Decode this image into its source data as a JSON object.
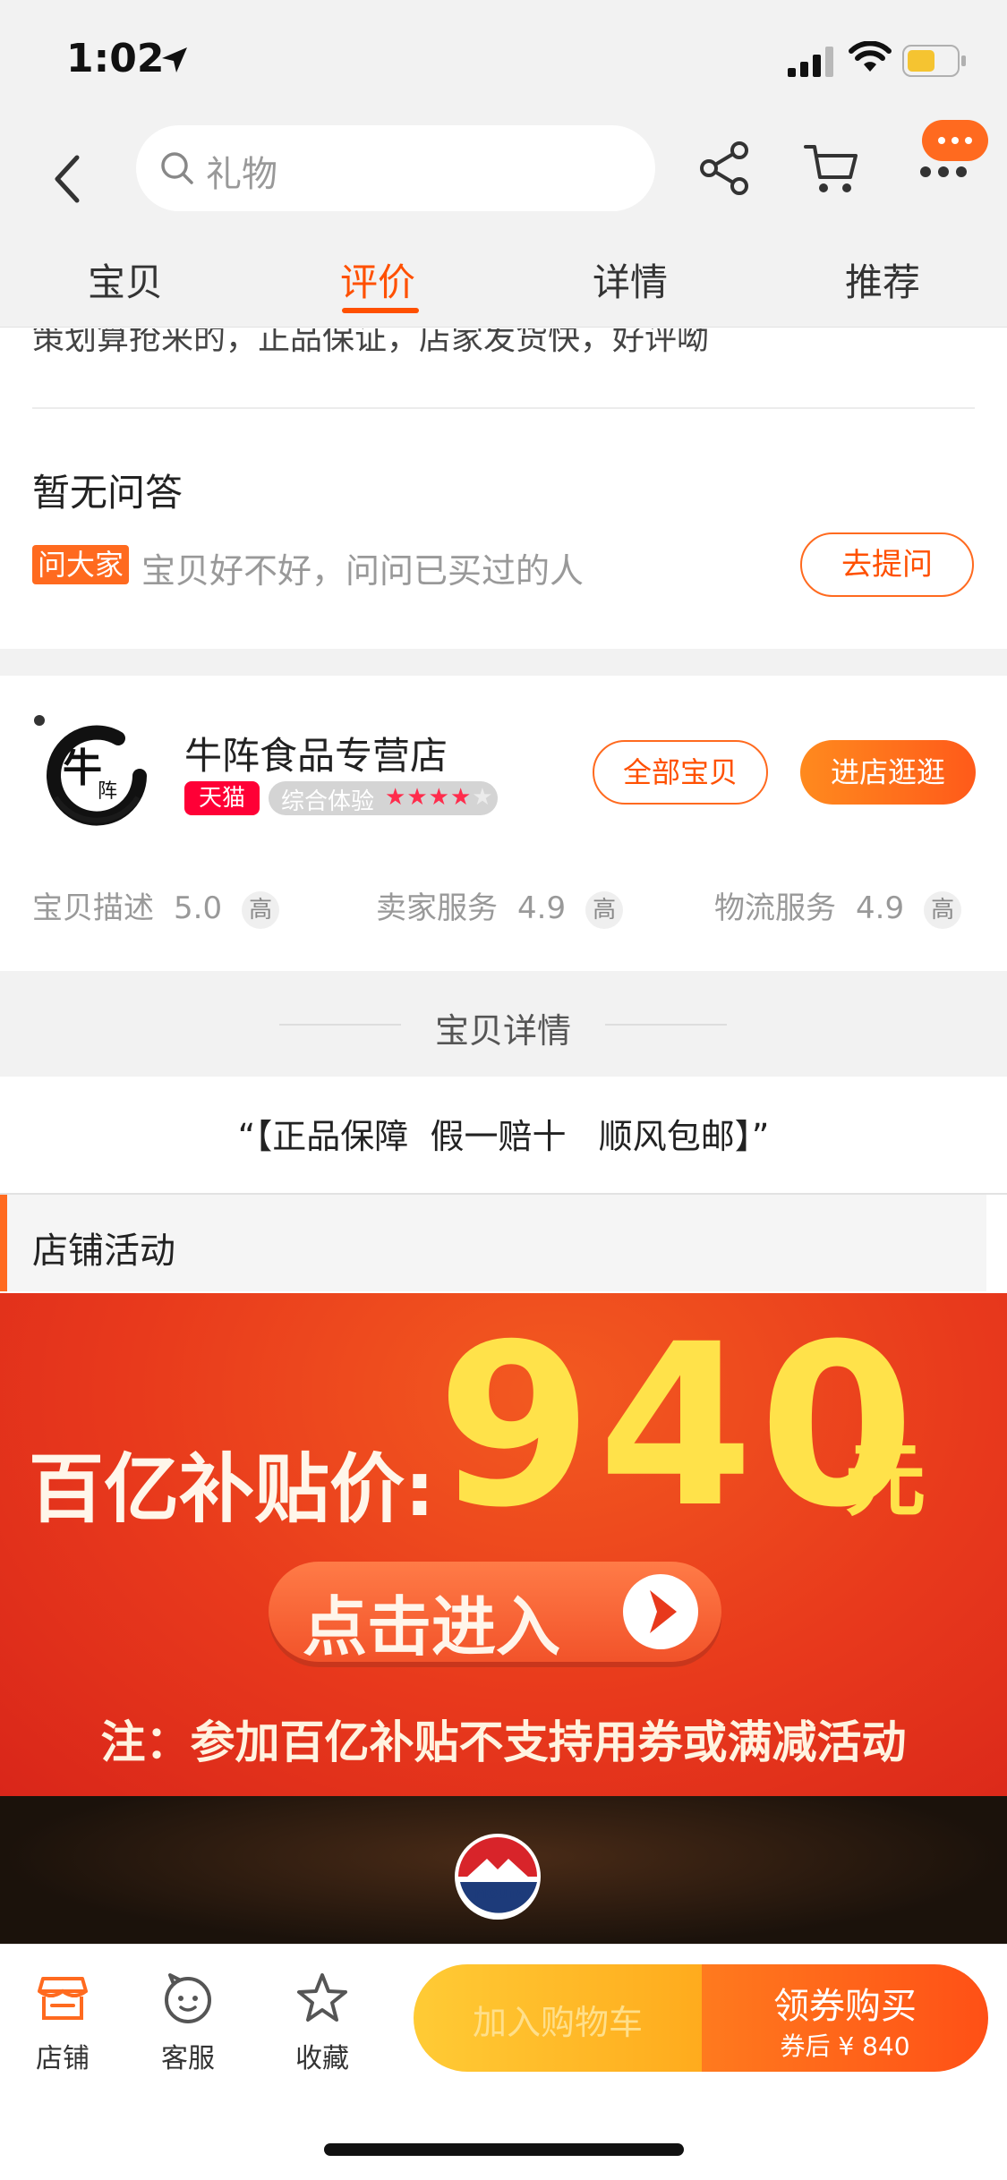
{
  "status": {
    "time": "1:02"
  },
  "search": {
    "placeholder": "礼物"
  },
  "tabs": [
    {
      "label": "宝贝"
    },
    {
      "label": "评价",
      "active": true
    },
    {
      "label": "详情"
    },
    {
      "label": "推荐"
    }
  ],
  "review_snippet": "策划算抢来的，正品保证，店家发货快，好评呦",
  "qa": {
    "title": "暂无问答",
    "badge": "问大家",
    "prompt": "宝贝好不好，问问已买过的人",
    "ask_button": "去提问"
  },
  "shop": {
    "logo_char_main": "牛",
    "logo_char_sub": "阵",
    "name": "牛阵食品专营店",
    "tmall_badge": "天猫",
    "experience_label": "综合体验",
    "experience_stars": 4,
    "experience_stars_max": 5,
    "all_items_button": "全部宝贝",
    "enter_shop_button": "进店逛逛",
    "ratings": [
      {
        "label": "宝贝描述",
        "score": "5.0",
        "level": "高"
      },
      {
        "label": "卖家服务",
        "score": "4.9",
        "level": "高"
      },
      {
        "label": "物流服务",
        "score": "4.9",
        "level": "高"
      }
    ]
  },
  "detail": {
    "section_title": "宝贝详情",
    "quote": "“【正品保障  假一赔十   顺风包邮】”",
    "activity_title": "店铺活动"
  },
  "promo": {
    "label": "百亿补贴价:",
    "price": "940",
    "unit": "元",
    "button": "点击进入",
    "note": "注：参加百亿补贴不支持用券或满减活动",
    "brand": "MOUTAI"
  },
  "bottom": {
    "shop": "店铺",
    "service": "客服",
    "favorite": "收藏",
    "add_to_cart": "加入购物车",
    "buy_title": "领券购买",
    "buy_sub": "券后 ¥ 840"
  },
  "colors": {
    "accent": "#ff5000",
    "tmall_red": "#ff0036",
    "promo_red": "#e8391c",
    "promo_yellow": "#ffe24a"
  }
}
